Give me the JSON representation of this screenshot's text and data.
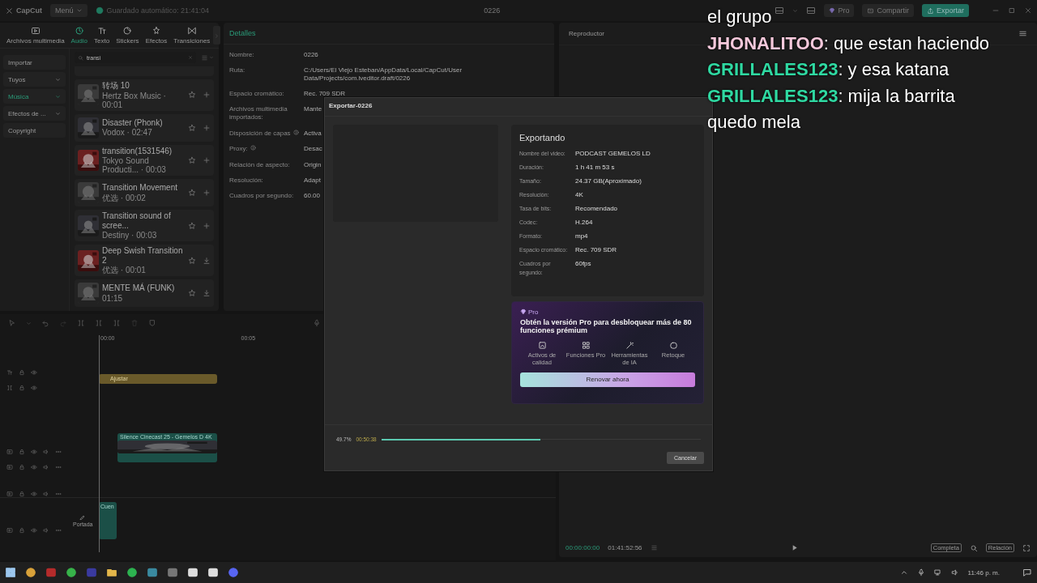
{
  "topbar": {
    "logo": "CapCut",
    "menu": "Menú",
    "autosave": "Guardado automático: 21:41:04",
    "project": "0226",
    "pro": "Pro",
    "share": "Compartir",
    "export": "Exportar"
  },
  "media_tabs": [
    {
      "label": "Archivos multimedia",
      "selected": false
    },
    {
      "label": "Audio",
      "selected": true
    },
    {
      "label": "Texto",
      "selected": false
    },
    {
      "label": "Stickers",
      "selected": false
    },
    {
      "label": "Efectos",
      "selected": false
    },
    {
      "label": "Transiciones",
      "selected": false
    }
  ],
  "sidebar": [
    {
      "label": "Importar",
      "selected": false,
      "dropdown": false
    },
    {
      "label": "Tuyos",
      "selected": false,
      "dropdown": true
    },
    {
      "label": "Música",
      "selected": true,
      "dropdown": true
    },
    {
      "label": "Efectos de ...",
      "selected": false,
      "dropdown": true
    },
    {
      "label": "Copyright",
      "selected": false,
      "dropdown": false
    }
  ],
  "search": {
    "value": "transi"
  },
  "sounds": [
    {
      "title": "转场 10",
      "meta": "Hertz Box Music · 00:01",
      "kind": "add"
    },
    {
      "title": "Disaster (Phonk)",
      "meta": "Vodox · 02:47",
      "kind": "add"
    },
    {
      "title": "transition(1531546)",
      "meta": "Tokyo Sound Producti... · 00:03",
      "kind": "add"
    },
    {
      "title": "Transition Movement",
      "meta": "优选 · 00:02",
      "kind": "add"
    },
    {
      "title": "Transition sound of scree...",
      "meta": "Destiny · 00:03",
      "kind": "add"
    },
    {
      "title": "Deep Swish Transition 2",
      "meta": "优选 · 00:01",
      "kind": "download"
    },
    {
      "title": "MENTE MÁ (FUNK)",
      "meta": "01:15",
      "kind": "download"
    }
  ],
  "details": {
    "title": "Detalles",
    "rows": [
      {
        "label": "Nombre:",
        "value": "0226",
        "info": false
      },
      {
        "label": "Ruta:",
        "value": "C:/Users/El Viejo Esteban/AppData/Local/CapCut/User Data/Projects/com.lveditor.draft/0226",
        "info": false
      },
      {
        "label": "Espacio cromático:",
        "value": "Rec. 709 SDR",
        "info": false
      },
      {
        "label": "Archivos multimedia importados:",
        "value": "Mante",
        "info": false
      },
      {
        "label": "Disposición de capas",
        "value": "Activa",
        "info": true
      },
      {
        "label": "Proxy:",
        "value": "Desac",
        "info": true
      },
      {
        "label": "Relación de aspecto:",
        "value": "Origin",
        "info": false
      },
      {
        "label": "Resolución:",
        "value": "Adapt",
        "info": false
      },
      {
        "label": "Cuadros por segundo:",
        "value": "60.00",
        "info": false
      }
    ]
  },
  "timeline": {
    "ruler": [
      "00:00",
      "00:05"
    ],
    "cover": "Portada",
    "clips": [
      {
        "kind": "adjust",
        "label": "Ajustar"
      },
      {
        "kind": "video",
        "label": "Silence  Cinecast 25 - Gemelos D 4K"
      },
      {
        "kind": "cover",
        "label": "Cuen"
      }
    ]
  },
  "player": {
    "title": "Reproductor",
    "current": "00:00:00:00",
    "total": "01:41:52:56",
    "options": [
      "Completa",
      "Relación"
    ]
  },
  "export": {
    "title": "Exportar-0226",
    "heading": "Exportando",
    "rows": [
      {
        "label": "Nombre del video:",
        "value": "PODCAST GEMELOS LD"
      },
      {
        "label": "Duración:",
        "value": "1 h 41 m 53 s"
      },
      {
        "label": "Tamaño:",
        "value": "24.37 GB(Aproximado)"
      },
      {
        "label": "Resolución:",
        "value": "4K"
      },
      {
        "label": "Tasa de bits:",
        "value": "Recomendado"
      },
      {
        "label": "Codec:",
        "value": "H.264"
      },
      {
        "label": "Formato:",
        "value": "mp4"
      },
      {
        "label": "Espacio cromático:",
        "value": "Rec. 709 SDR"
      },
      {
        "label": "Cuadros por segundo:",
        "value": "60fps"
      }
    ],
    "pro": {
      "badge": "Pro",
      "text": "Obtén la versión Pro para desbloquear más de 80 funciones prémium",
      "features": [
        "Activos de calidad",
        "Funciones Pro",
        "Herramientas de IA",
        "Retoque"
      ],
      "button": "Renovar ahora"
    },
    "progress": {
      "percent": "49.7%",
      "elapsed": "00:50:38",
      "level": 0.497
    },
    "cancel": "Cancelar"
  },
  "chat": [
    {
      "text": "el grupo"
    },
    {
      "user": "JHONALITOO",
      "text": ": que estan haciendo",
      "color": "#f6c9dc"
    },
    {
      "user": "GRILLALES123",
      "text": ": y esa katana",
      "color": "#2fd9a2"
    },
    {
      "user": "GRILLALES123",
      "text": ": mija la barrita quedo mela",
      "color": "#2fd9a2"
    }
  ],
  "taskbar": {
    "time": "11:46 p. m."
  }
}
